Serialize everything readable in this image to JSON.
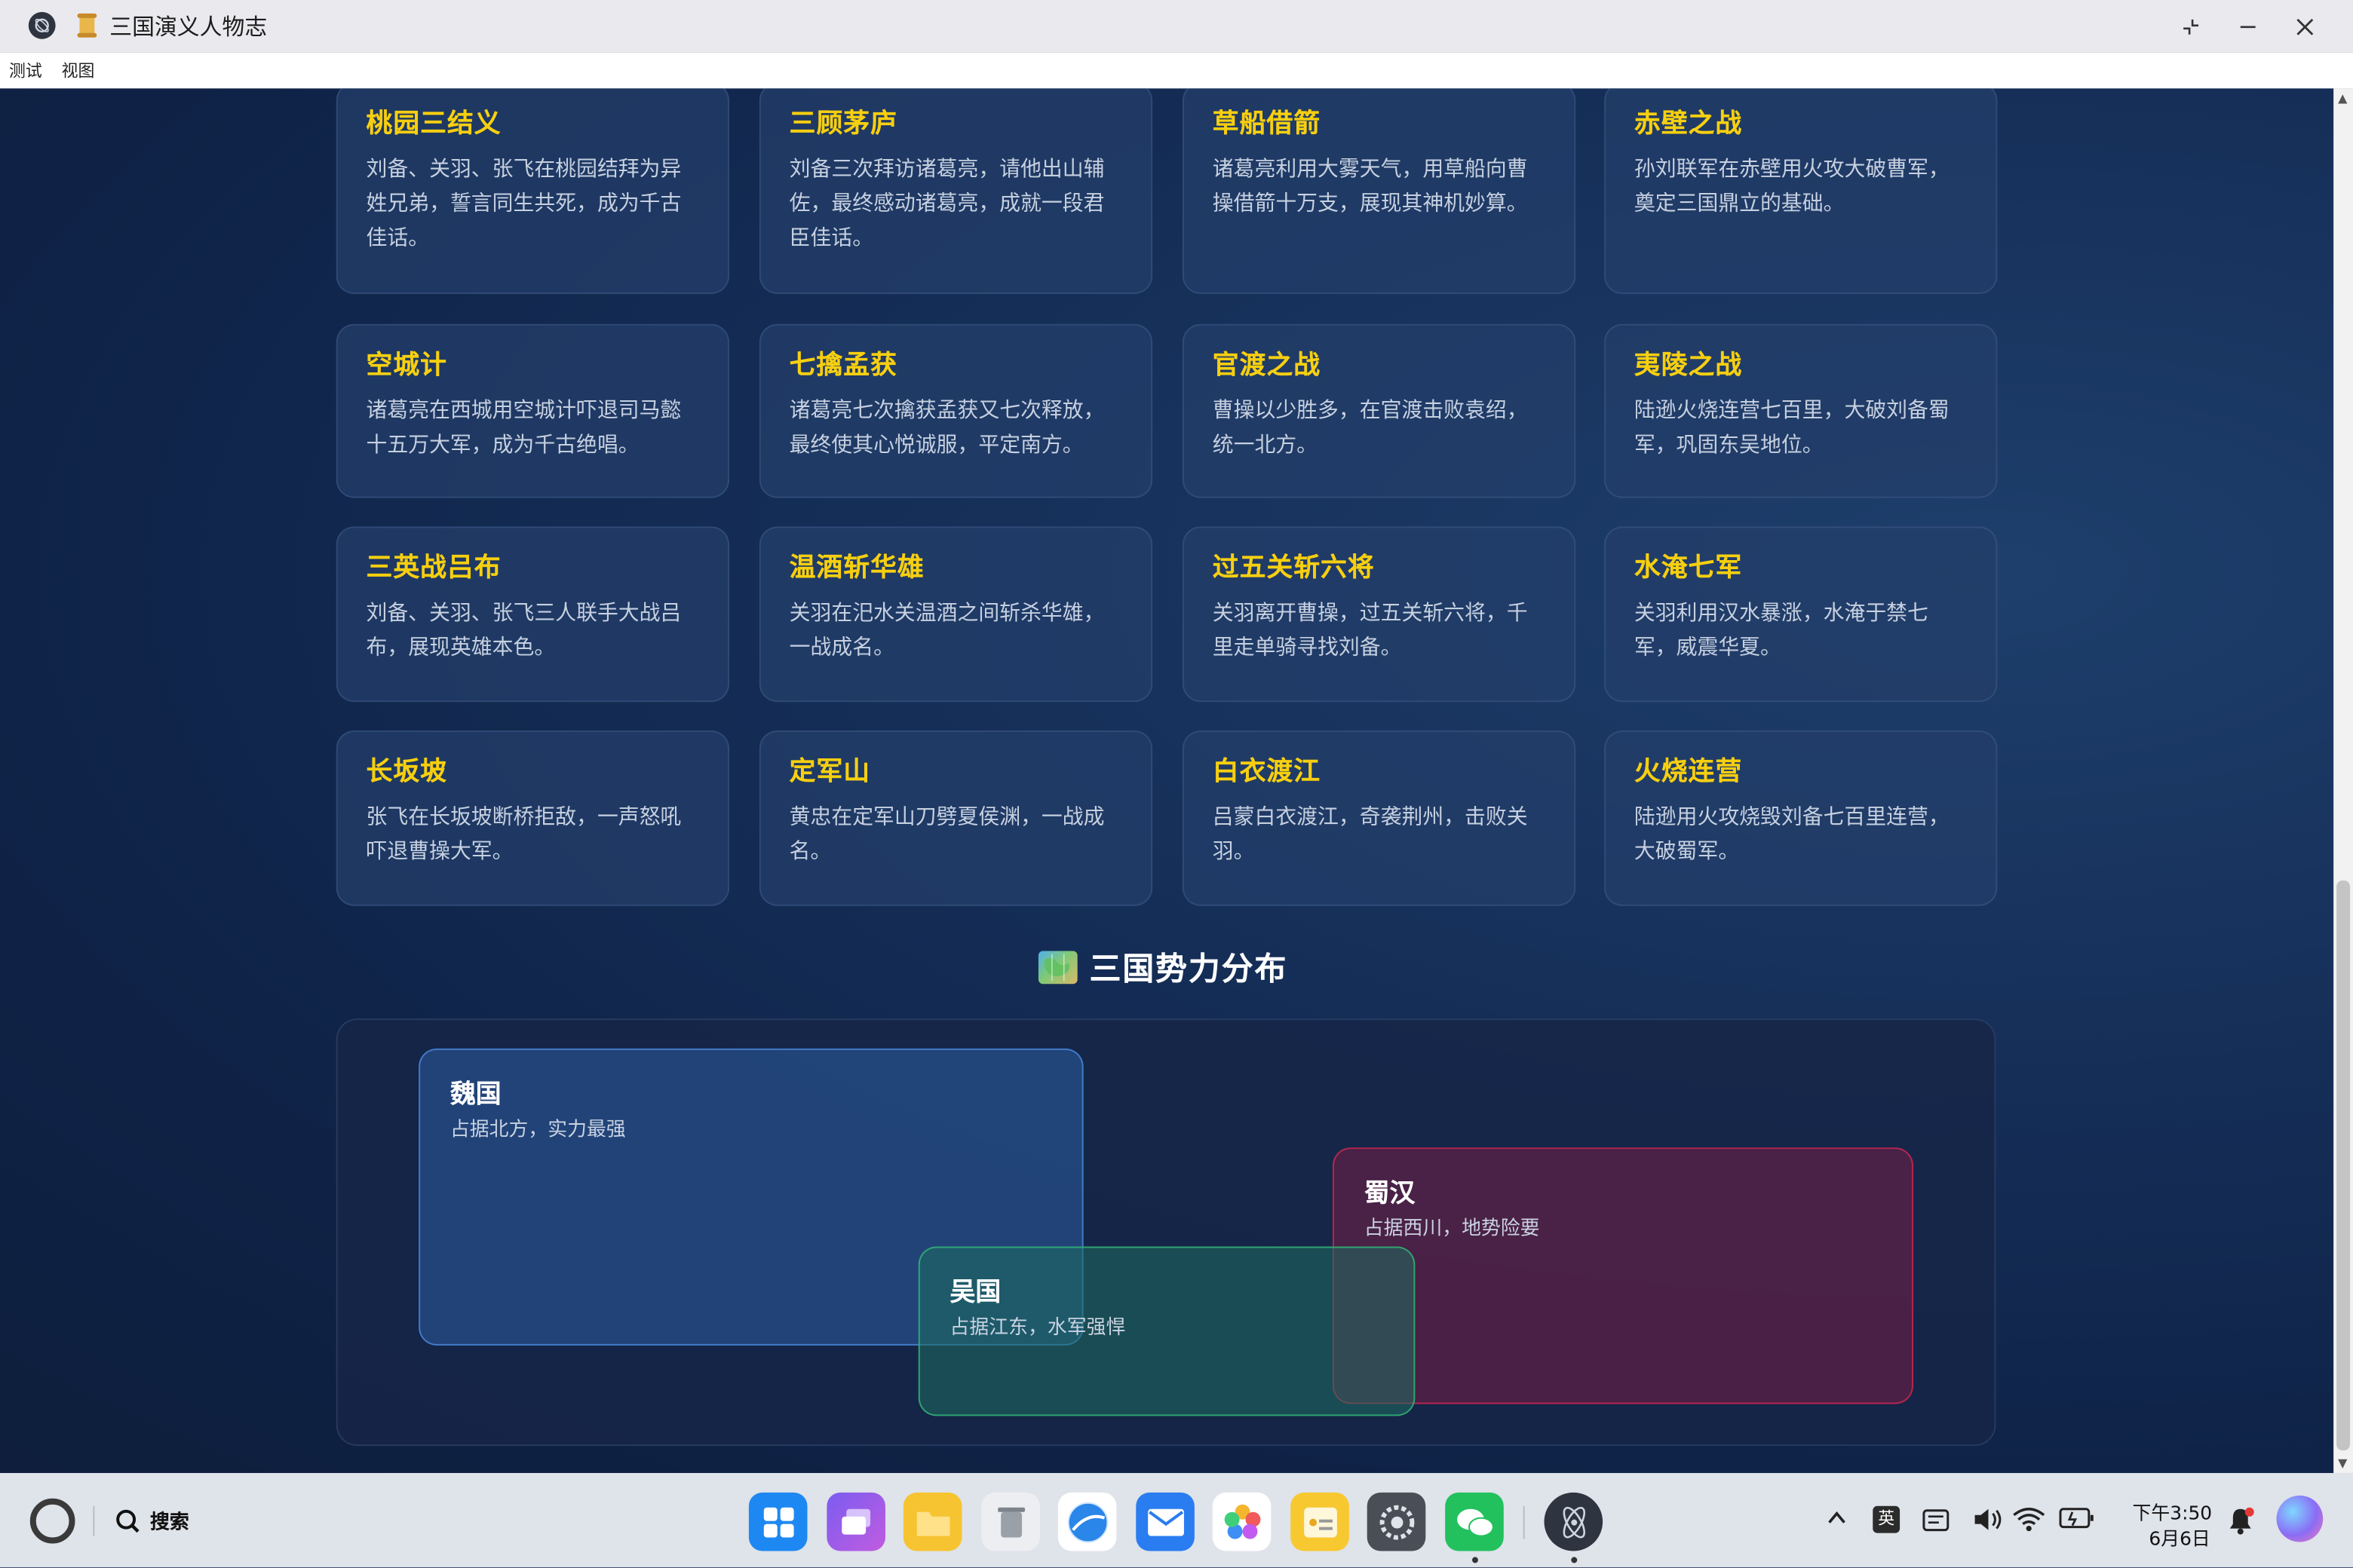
{
  "window": {
    "title": "三国演义人物志",
    "menu": [
      "测试",
      "视图"
    ]
  },
  "story_cards": [
    {
      "title": "桃园三结义",
      "desc": "刘备、关羽、张飞在桃园结拜为异姓兄弟，誓言同生共死，成为千古佳话。"
    },
    {
      "title": "三顾茅庐",
      "desc": "刘备三次拜访诸葛亮，请他出山辅佐，最终感动诸葛亮，成就一段君臣佳话。"
    },
    {
      "title": "草船借箭",
      "desc": "诸葛亮利用大雾天气，用草船向曹操借箭十万支，展现其神机妙算。"
    },
    {
      "title": "赤壁之战",
      "desc": "孙刘联军在赤壁用火攻大破曹军，奠定三国鼎立的基础。"
    },
    {
      "title": "空城计",
      "desc": "诸葛亮在西城用空城计吓退司马懿十五万大军，成为千古绝唱。"
    },
    {
      "title": "七擒孟获",
      "desc": "诸葛亮七次擒获孟获又七次释放，最终使其心悦诚服，平定南方。"
    },
    {
      "title": "官渡之战",
      "desc": "曹操以少胜多，在官渡击败袁绍，统一北方。"
    },
    {
      "title": "夷陵之战",
      "desc": "陆逊火烧连营七百里，大破刘备蜀军，巩固东吴地位。"
    },
    {
      "title": "三英战吕布",
      "desc": "刘备、关羽、张飞三人联手大战吕布，展现英雄本色。"
    },
    {
      "title": "温酒斩华雄",
      "desc": "关羽在汜水关温酒之间斩杀华雄，一战成名。"
    },
    {
      "title": "过五关斩六将",
      "desc": "关羽离开曹操，过五关斩六将，千里走单骑寻找刘备。"
    },
    {
      "title": "水淹七军",
      "desc": "关羽利用汉水暴涨，水淹于禁七军，威震华夏。"
    },
    {
      "title": "长坂坡",
      "desc": "张飞在长坂坡断桥拒敌，一声怒吼吓退曹操大军。"
    },
    {
      "title": "定军山",
      "desc": "黄忠在定军山刀劈夏侯渊，一战成名。"
    },
    {
      "title": "白衣渡江",
      "desc": "吕蒙白衣渡江，奇袭荆州，击败关羽。"
    },
    {
      "title": "火烧连营",
      "desc": "陆逊用火攻烧毁刘备七百里连营，大破蜀军。"
    }
  ],
  "territory": {
    "heading": "三国势力分布",
    "heading_icon": "world-map-icon",
    "kingdoms": [
      {
        "name": "魏国",
        "desc": "占据北方，实力最强",
        "color": "#2c5ca0"
      },
      {
        "name": "蜀汉",
        "desc": "占据西川，地势险要",
        "color": "#c82850"
      },
      {
        "name": "吴国",
        "desc": "占据江东，水军强悍",
        "color": "#32b478"
      }
    ]
  },
  "taskbar": {
    "search_label": "搜索",
    "ime": "英",
    "time": "下午3:50",
    "date": "6月6日"
  },
  "colors": {
    "card_title": "#f7cf10",
    "background": "#0f2348"
  }
}
